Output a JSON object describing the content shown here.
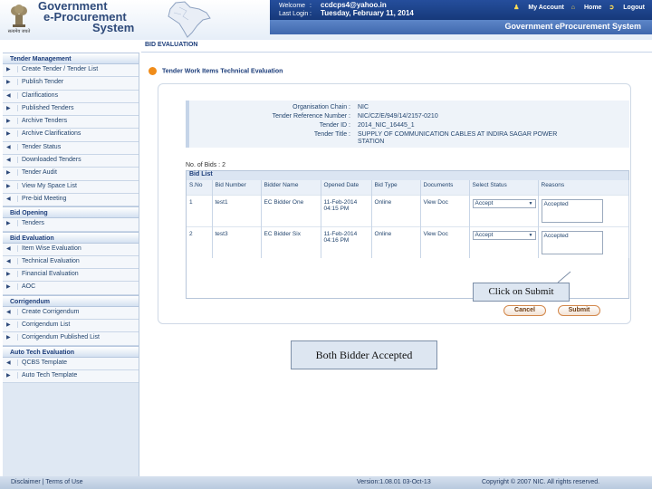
{
  "header": {
    "brand_lines": [
      "Government",
      "e-Procurement",
      "System"
    ],
    "emblem_caption": "सत्यमेव जयते",
    "welcome_key": "Welcome",
    "welcome_value": "ccdcps4@yahoo.in",
    "lastlogin_key": "Last Login",
    "lastlogin_value": "Tuesday, February 11, 2014",
    "links": {
      "account": "My Account",
      "home": "Home",
      "logout": "Logout"
    },
    "system_name": "Government eProcurement System"
  },
  "sidebar": {
    "sections": [
      {
        "title": "Tender Management",
        "items": [
          "Create Tender / Tender List",
          "Publish Tender",
          "Clarifications",
          "Published Tenders",
          "Archive Tenders",
          "Archive Clarifications",
          "Tender Status",
          "Downloaded Tenders",
          "Tender Audit",
          "View My Space List",
          "Pre-bid Meeting"
        ]
      },
      {
        "title": "Bid Opening",
        "items": [
          "Tenders"
        ]
      },
      {
        "title": "Bid Evaluation",
        "items": [
          "Item Wise Evaluation",
          "Technical Evaluation",
          "Financial Evaluation",
          "AOC"
        ]
      },
      {
        "title": "Corrigendum",
        "items": [
          "Create Corrigendum",
          "Corrigendum List",
          "Corrigendum Published List"
        ]
      },
      {
        "title": "Auto Tech Evaluation",
        "items": [
          "QCBS Template",
          "Auto Tech Template"
        ]
      }
    ]
  },
  "main": {
    "page_title": "BID EVALUATION",
    "section_heading": "Tender Work Items Technical Evaluation",
    "info": [
      {
        "key": "Organisation Chain :",
        "value": "NIC"
      },
      {
        "key": "Tender Reference Number :",
        "value": "NIC/CZ/E/949/14/2157-0210"
      },
      {
        "key": "Tender ID :",
        "value": "2014_NIC_16445_1"
      },
      {
        "key": "Tender Title :",
        "value": "SUPPLY OF COMMUNICATION CABLES AT INDIRA SAGAR POWER STATION"
      }
    ],
    "num_bids": "No. of Bids : 2",
    "bid_list_title": "Bid List",
    "columns": [
      "S.No",
      "Bid Number",
      "Bidder Name",
      "Opened Date",
      "Bid Type",
      "Documents",
      "Select Status",
      "Reasons"
    ],
    "rows": [
      {
        "sno": "1",
        "bid": "test1",
        "bidder": "EC Bidder One",
        "date": "11-Feb-2014 04:15 PM",
        "type": "Online",
        "docs": "View Doc",
        "status": "Accept",
        "reason": "Accepted"
      },
      {
        "sno": "2",
        "bid": "test3",
        "bidder": "EC Bidder Six",
        "date": "11-Feb-2014 04:16 PM",
        "type": "Online",
        "docs": "View Doc",
        "status": "Accept",
        "reason": "Accepted"
      }
    ],
    "cancel_label": "Cancel",
    "submit_label": "Submit",
    "callout_submit": "Click on Submit",
    "callout_both": "Both Bidder Accepted"
  },
  "footer": {
    "links": "Disclaimer | Terms of Use",
    "version": "Version:1.08.01 03-Oct-13",
    "copyright": "Copyright © 2007 NIC. All rights reserved."
  }
}
